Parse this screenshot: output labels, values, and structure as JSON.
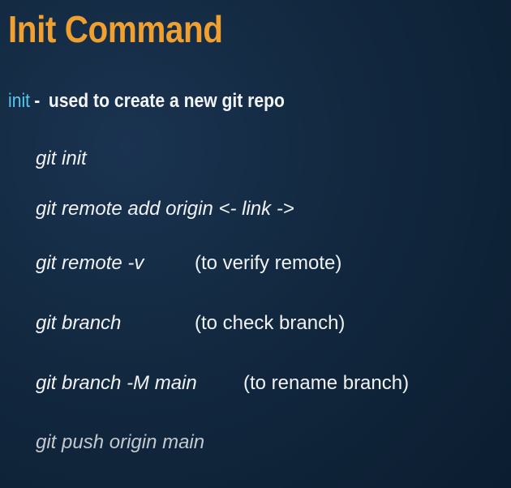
{
  "slide": {
    "title": "Init Command",
    "subtitle": {
      "keyword": "init",
      "dash": "-",
      "description": "used to create a new git repo"
    },
    "commands": [
      {
        "command": "git init",
        "note": ""
      },
      {
        "command": "git remote add origin <- link ->",
        "note": ""
      },
      {
        "command": "git remote -v",
        "note": "(to verify remote)"
      },
      {
        "command": "git branch",
        "note": "(to check branch)"
      },
      {
        "command": "git branch -M main",
        "note": "(to rename branch)"
      },
      {
        "command": "git push origin main",
        "note": ""
      }
    ]
  },
  "colors": {
    "background": "#12283f",
    "title": "#f0a030",
    "keyword": "#58c8f0",
    "text": "#f2f4f7"
  }
}
